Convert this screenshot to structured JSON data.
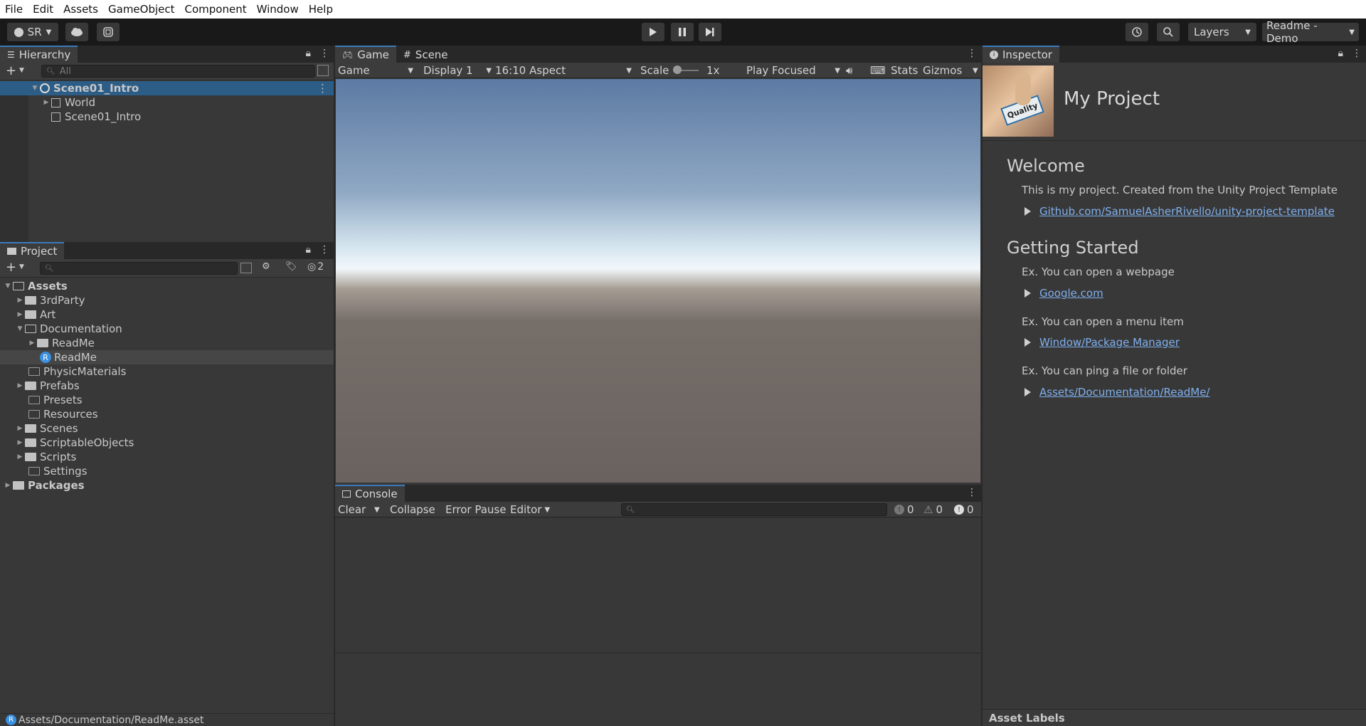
{
  "menu": [
    "File",
    "Edit",
    "Assets",
    "GameObject",
    "Component",
    "Window",
    "Help"
  ],
  "toolbar": {
    "account": "SR",
    "layers": "Layers",
    "layout": "Readme - Demo"
  },
  "hierarchy": {
    "tab": "Hierarchy",
    "search_placeholder": "All",
    "scene": "Scene01_Intro",
    "items": [
      "World",
      "Scene01_Intro"
    ]
  },
  "project": {
    "tab": "Project",
    "hidden_count": "2",
    "root": "Assets",
    "items": [
      "3rdParty",
      "Art",
      "Documentation",
      "ReadMe",
      "ReadMe",
      "PhysicMaterials",
      "Prefabs",
      "Presets",
      "Resources",
      "Scenes",
      "ScriptableObjects",
      "Scripts",
      "Settings"
    ],
    "packages": "Packages"
  },
  "game": {
    "tabs": [
      "Game",
      "Scene"
    ],
    "mode": "Game",
    "display": "Display 1",
    "aspect": "16:10 Aspect",
    "scale_label": "Scale",
    "scale_value": "1x",
    "play_mode": "Play Focused",
    "stats": "Stats",
    "gizmos": "Gizmos"
  },
  "console": {
    "tab": "Console",
    "clear": "Clear",
    "collapse": "Collapse",
    "error_pause": "Error Pause",
    "editor": "Editor",
    "info_count": "0",
    "warn_count": "0",
    "error_count": "0"
  },
  "inspector": {
    "tab": "Inspector",
    "title": "My Project",
    "thumb_text": "Quality",
    "welcome_heading": "Welcome",
    "welcome_text": "This is my project. Created from the Unity Project Template",
    "welcome_link": "Github.com/SamuelAsherRivello/unity-project-template",
    "started_heading": "Getting Started",
    "ex1": "Ex. You can open a webpage",
    "link1": "Google.com",
    "ex2": "Ex. You can open a menu item",
    "link2": "Window/Package Manager",
    "ex3": "Ex. You can ping a file or folder",
    "link3": "Assets/Documentation/ReadMe/",
    "asset_labels": "Asset Labels"
  },
  "status": {
    "path": "Assets/Documentation/ReadMe.asset"
  },
  "colors": {
    "accent": "#3a79bb",
    "link": "#7fb0ee",
    "selected_row": "#2c5d87"
  }
}
